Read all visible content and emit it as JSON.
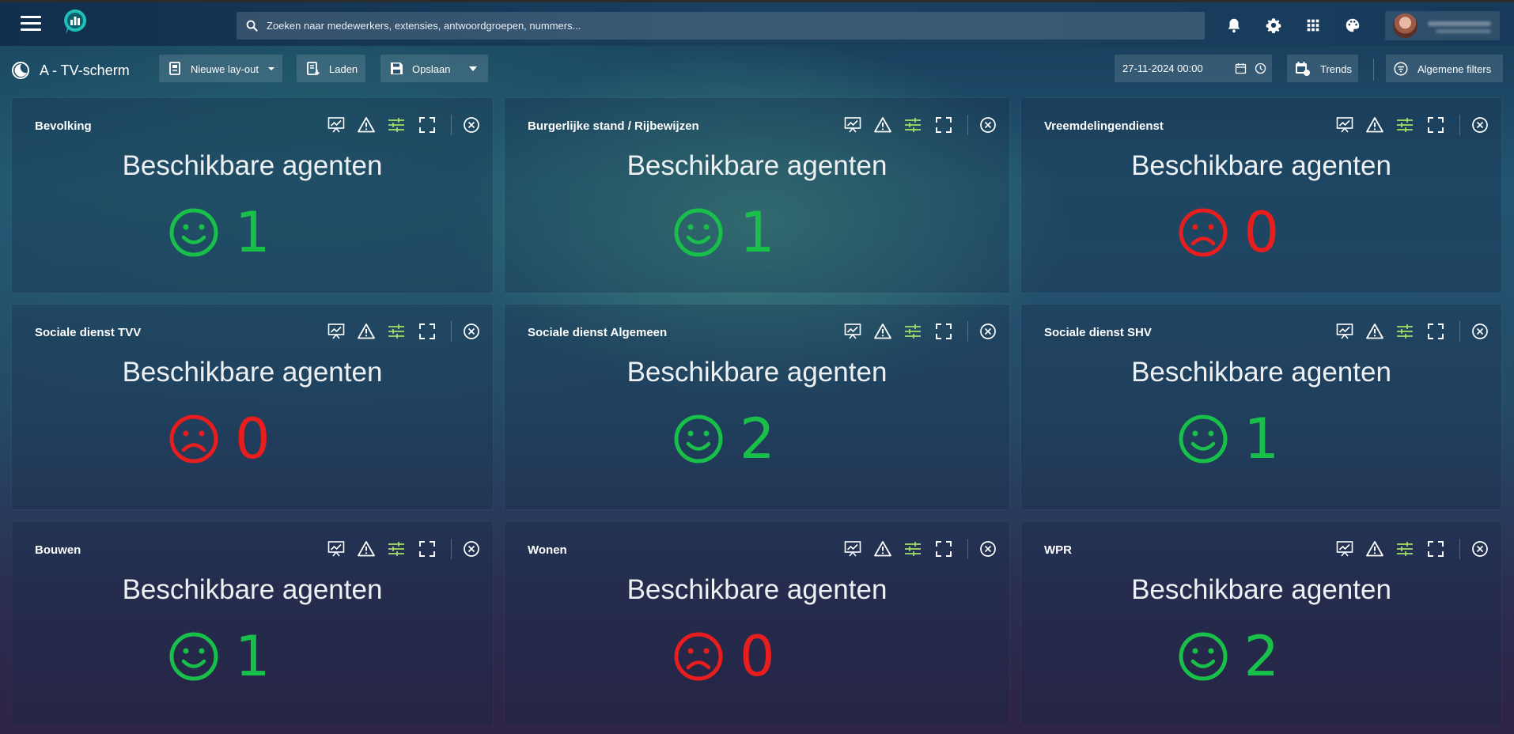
{
  "header": {
    "search_placeholder": "Zoeken naar medewerkers, extensies, antwoordgroepen, nummers..."
  },
  "toolbar": {
    "page_title": "A - TV-scherm",
    "new_layout_label": "Nieuwe lay-out",
    "load_label": "Laden",
    "save_label": "Opslaan",
    "date_value": "27-11-2024 00:00",
    "trends_label": "Trends",
    "filters_label": "Algemene filters"
  },
  "colors": {
    "available": "#18c04a",
    "unavailable": "#e81e1e",
    "accent_sliders": "#a6e06a"
  },
  "panels": [
    {
      "title": "Bevolking",
      "metric": "Beschikbare agenten",
      "value": "1",
      "status": "happy"
    },
    {
      "title": "Burgerlijke stand / Rijbewijzen",
      "metric": "Beschikbare agenten",
      "value": "1",
      "status": "happy"
    },
    {
      "title": "Vreemdelingendienst",
      "metric": "Beschikbare agenten",
      "value": "0",
      "status": "sad"
    },
    {
      "title": "Sociale dienst TVV",
      "metric": "Beschikbare agenten",
      "value": "0",
      "status": "sad"
    },
    {
      "title": "Sociale dienst Algemeen",
      "metric": "Beschikbare agenten",
      "value": "2",
      "status": "happy"
    },
    {
      "title": "Sociale dienst SHV",
      "metric": "Beschikbare agenten",
      "value": "1",
      "status": "happy"
    },
    {
      "title": "Bouwen",
      "metric": "Beschikbare agenten",
      "value": "1",
      "status": "happy"
    },
    {
      "title": "Wonen",
      "metric": "Beschikbare agenten",
      "value": "0",
      "status": "sad"
    },
    {
      "title": "WPR",
      "metric": "Beschikbare agenten",
      "value": "2",
      "status": "happy"
    }
  ]
}
